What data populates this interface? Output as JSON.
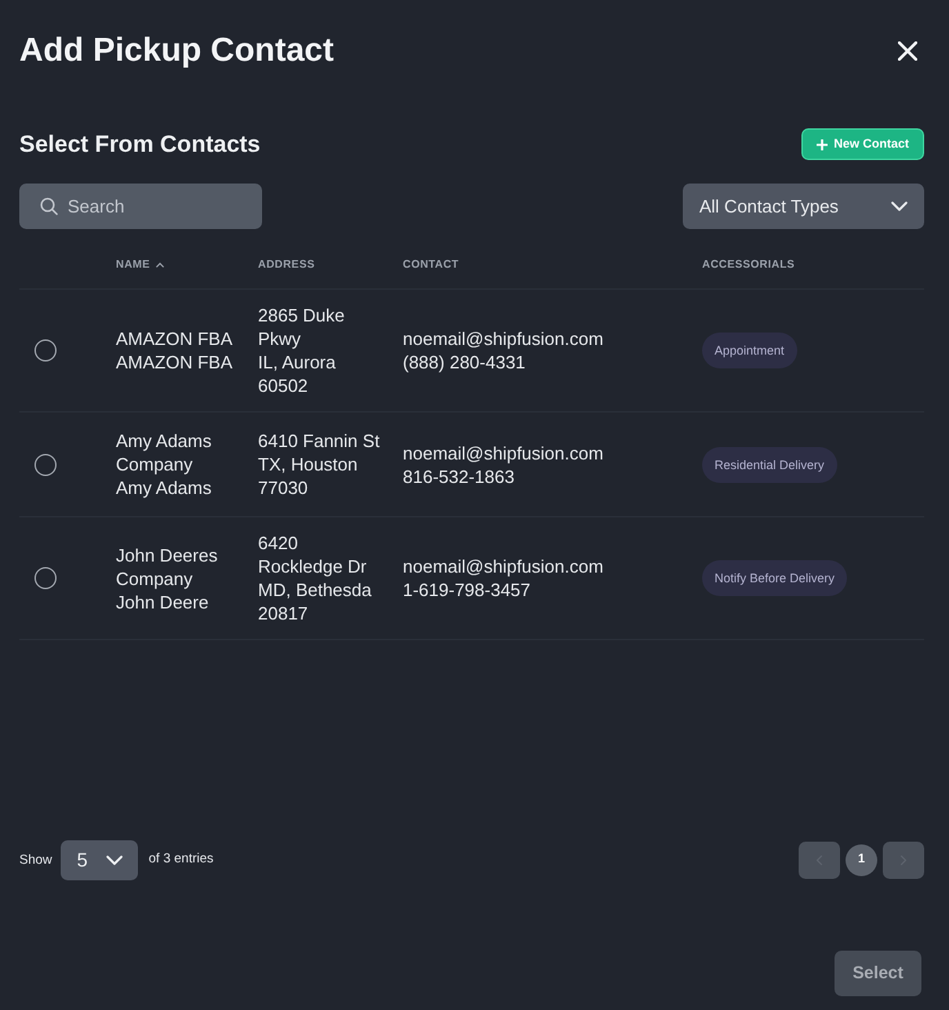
{
  "dialog": {
    "title": "Add Pickup Contact"
  },
  "section": {
    "title": "Select From Contacts",
    "new_contact_button": "New Contact"
  },
  "search": {
    "placeholder": "Search"
  },
  "type_filter": {
    "value": "All Contact Types"
  },
  "table": {
    "columns": [
      {
        "label": "NAME",
        "sorted": true
      },
      {
        "label": "ADDRESS",
        "sorted": false
      },
      {
        "label": "CONTACT",
        "sorted": false
      },
      {
        "label": "ACCESSORIALS",
        "sorted": false
      }
    ],
    "rows": [
      {
        "selected": false,
        "company": "AMAZON FBA",
        "person": "AMAZON FBA",
        "address": [
          "2865 Duke Pkwy",
          "IL, Aurora 60502"
        ],
        "email": "noemail@shipfusion.com",
        "phone": "(888) 280-4331",
        "accessorials": [
          "Appointment"
        ]
      },
      {
        "selected": false,
        "company": "Amy Adams Company",
        "person": "Amy Adams",
        "address": [
          "6410 Fannin St",
          "TX, Houston 77030"
        ],
        "email": "noemail@shipfusion.com",
        "phone": "816-532-1863",
        "accessorials": [
          "Residential Delivery"
        ]
      },
      {
        "selected": false,
        "company": "John Deeres Company",
        "person": "John Deere",
        "address": [
          "6420 Rockledge Dr",
          "MD, Bethesda 20817"
        ],
        "email": "noemail@shipfusion.com",
        "phone": "1-619-798-3457",
        "accessorials": [
          "Notify Before Delivery"
        ]
      }
    ]
  },
  "footer": {
    "show_label": "Show",
    "page_size": "5",
    "entries_text": "of 3 entries"
  },
  "pagination": {
    "prev_disabled": true,
    "next_disabled": true,
    "pages": [
      {
        "label": "1",
        "selected": true
      }
    ]
  },
  "select_button": {
    "label": "Select",
    "disabled": true
  }
}
